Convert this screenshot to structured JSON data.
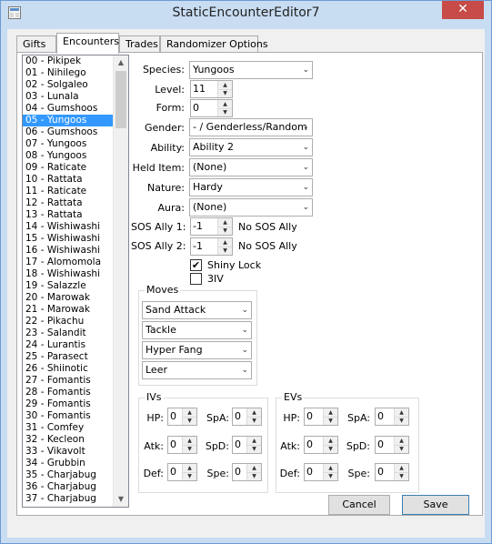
{
  "window": {
    "title": "StaticEncounterEditor7",
    "close_glyph": "✕"
  },
  "tabs": [
    {
      "label": "Gifts"
    },
    {
      "label": "Encounters"
    },
    {
      "label": "Trades"
    },
    {
      "label": "Randomizer Options"
    }
  ],
  "encounter_list": {
    "selected": "05 - Yungoos",
    "items": [
      "00 - Pikipek",
      "01 - Nihilego",
      "02 - Solgaleo",
      "03 - Lunala",
      "04 - Gumshoos",
      "05 - Yungoos",
      "06 - Gumshoos",
      "07 - Yungoos",
      "08 - Yungoos",
      "09 - Raticate",
      "10 - Rattata",
      "11 - Raticate",
      "12 - Rattata",
      "13 - Rattata",
      "14 - Wishiwashi",
      "15 - Wishiwashi",
      "16 - Wishiwashi",
      "17 - Alomomola",
      "18 - Wishiwashi",
      "19 - Salazzle",
      "20 - Marowak",
      "21 - Marowak",
      "22 - Pikachu",
      "23 - Salandit",
      "24 - Lurantis",
      "25 - Parasect",
      "26 - Shiinotic",
      "27 - Fomantis",
      "28 - Fomantis",
      "29 - Fomantis",
      "30 - Fomantis",
      "31 - Comfey",
      "32 - Kecleon",
      "33 - Vikavolt",
      "34 - Grubbin",
      "35 - Charjabug",
      "36 - Charjabug",
      "37 - Charjabug"
    ]
  },
  "form": {
    "species": {
      "label": "Species:",
      "value": "Yungoos"
    },
    "level": {
      "label": "Level:",
      "value": "11"
    },
    "form": {
      "label": "Form:",
      "value": "0"
    },
    "gender": {
      "label": "Gender:",
      "value": "- / Genderless/Random"
    },
    "ability": {
      "label": "Ability:",
      "value": "Ability 2"
    },
    "held_item": {
      "label": "Held Item:",
      "value": "(None)"
    },
    "nature": {
      "label": "Nature:",
      "value": "Hardy"
    },
    "aura": {
      "label": "Aura:",
      "value": "(None)"
    },
    "sos1": {
      "label": "SOS Ally 1:",
      "value": "-1",
      "note": "No SOS Ally"
    },
    "sos2": {
      "label": "SOS Ally 2:",
      "value": "-1",
      "note": "No SOS Ally"
    },
    "shiny_lock": {
      "label": "Shiny Lock",
      "checked": true,
      "mark": "✔"
    },
    "three_iv": {
      "label": "3IV",
      "checked": false
    }
  },
  "moves": {
    "title": "Moves",
    "items": [
      "Sand Attack",
      "Tackle",
      "Hyper Fang",
      "Leer"
    ]
  },
  "ivs": {
    "title": "IVs",
    "hp": {
      "label": "HP:",
      "value": "0"
    },
    "atk": {
      "label": "Atk:",
      "value": "0"
    },
    "def": {
      "label": "Def:",
      "value": "0"
    },
    "spa": {
      "label": "SpA:",
      "value": "0"
    },
    "spd": {
      "label": "SpD:",
      "value": "0"
    },
    "spe": {
      "label": "Spe:",
      "value": "0"
    }
  },
  "evs": {
    "title": "EVs",
    "hp": {
      "label": "HP:",
      "value": "0"
    },
    "atk": {
      "label": "Atk:",
      "value": "0"
    },
    "def": {
      "label": "Def:",
      "value": "0"
    },
    "spa": {
      "label": "SpA:",
      "value": "0"
    },
    "spd": {
      "label": "SpD:",
      "value": "0"
    },
    "spe": {
      "label": "Spe:",
      "value": "0"
    }
  },
  "buttons": {
    "cancel": "Cancel",
    "save": "Save"
  },
  "glyphs": {
    "dropdown": "⌄",
    "spin_up": "▲",
    "spin_down": "▼",
    "scroll_up": "▲",
    "scroll_down": "▼"
  }
}
